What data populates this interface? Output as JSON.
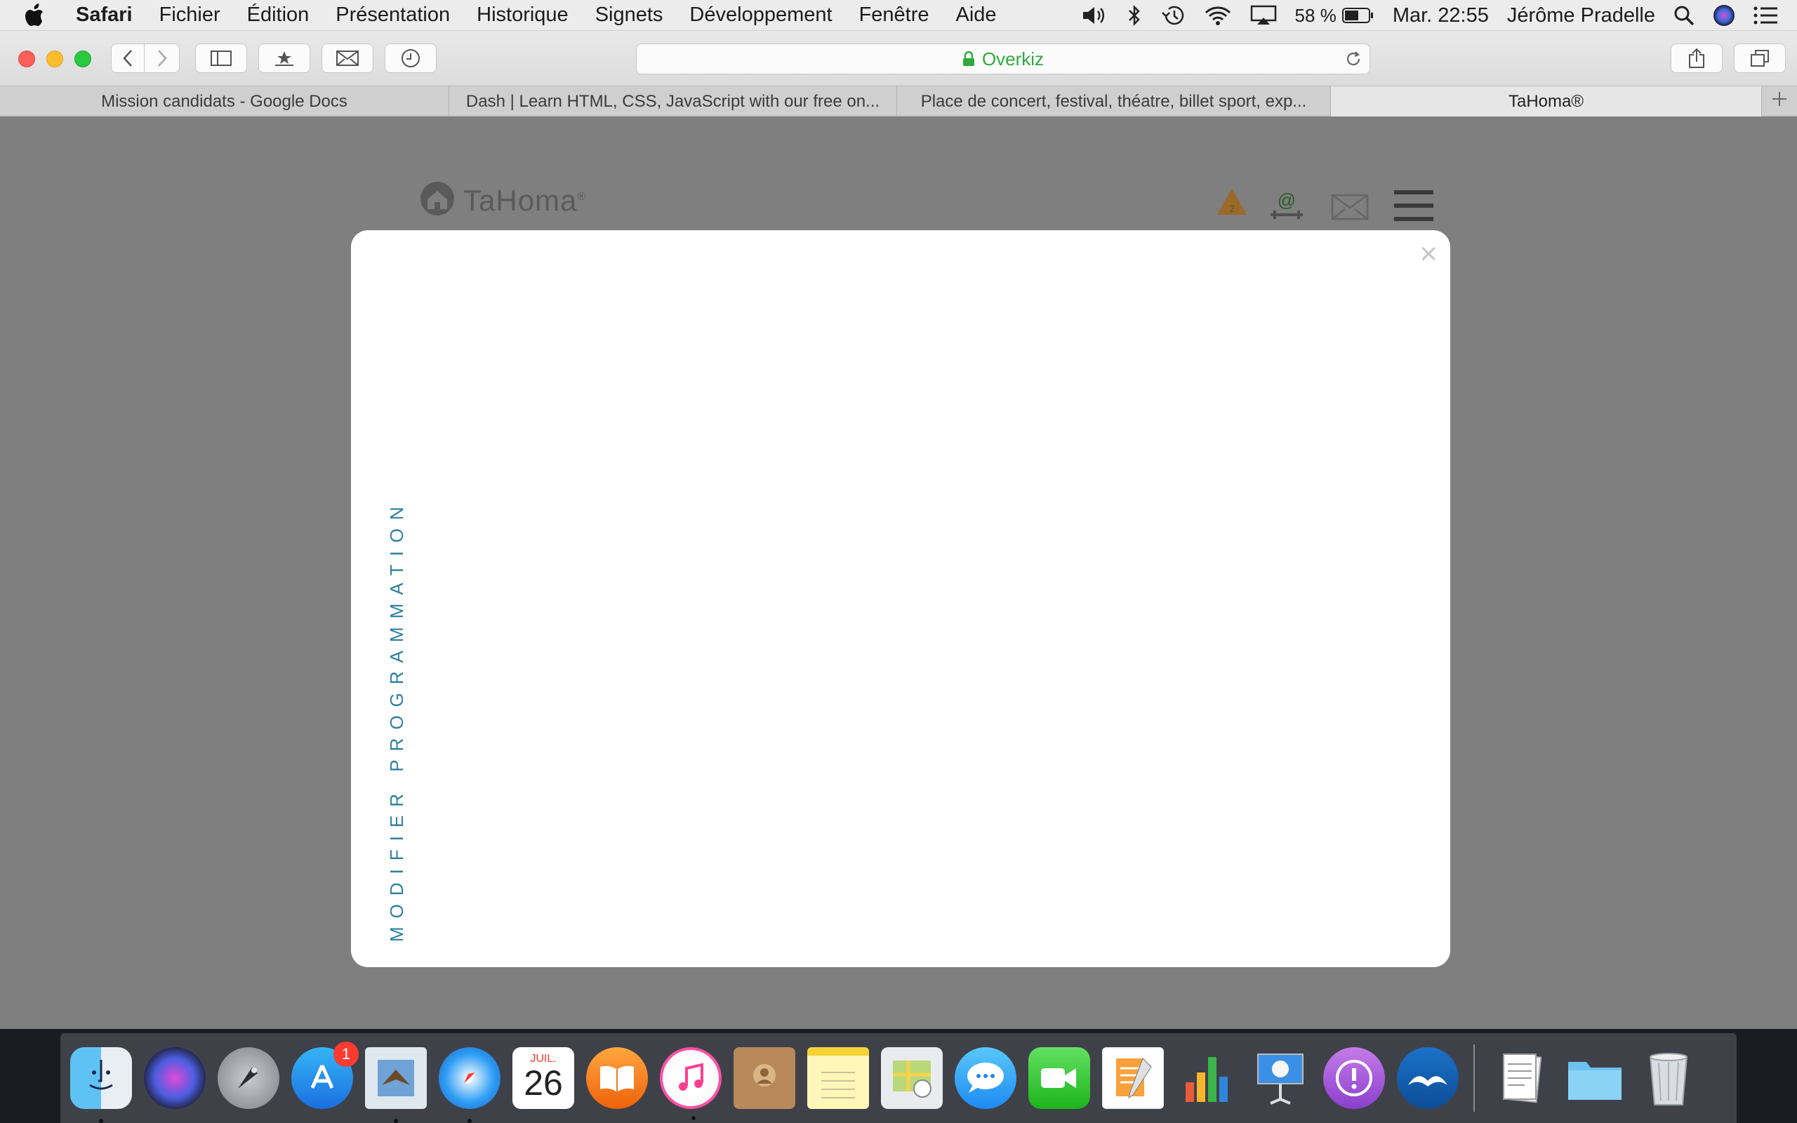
{
  "menubar": {
    "app": "Safari",
    "items": [
      "Fichier",
      "Édition",
      "Présentation",
      "Historique",
      "Signets",
      "Développement",
      "Fenêtre",
      "Aide"
    ],
    "battery": "58 %",
    "clock": "Mar. 22:55",
    "user": "Jérôme Pradelle"
  },
  "browser": {
    "address": "Overkiz",
    "tabs": [
      "Mission candidats - Google Docs",
      "Dash | Learn HTML, CSS, JavaScript with our free on...",
      "Place de concert, festival, théatre, billet sport, exp...",
      "TaHoma®"
    ],
    "active_tab": 3
  },
  "site": {
    "logo": "TaHoma",
    "logo_mark": "®",
    "alert_count": "2",
    "connector_symbol": "@"
  },
  "modal": {
    "close": "×",
    "vertical_label": "MODIFIER PROGRAMMATION"
  },
  "dock": {
    "calendar_month": "JUIL.",
    "calendar_day": "26",
    "appstore_badge": "1",
    "apps": [
      "finder",
      "siri",
      "launchpad",
      "app-store",
      "mail-preview",
      "safari",
      "calendar",
      "ibooks",
      "itunes",
      "contacts",
      "notes",
      "maps",
      "messages",
      "facetime",
      "pages",
      "numbers",
      "keynote",
      "feedback",
      "openoffice",
      "documents",
      "folder",
      "trash"
    ]
  },
  "colors": {
    "modal_accent": "#2e7fa0",
    "address_green": "#2eaa3c",
    "page_overlay": "#7f7f7f"
  }
}
